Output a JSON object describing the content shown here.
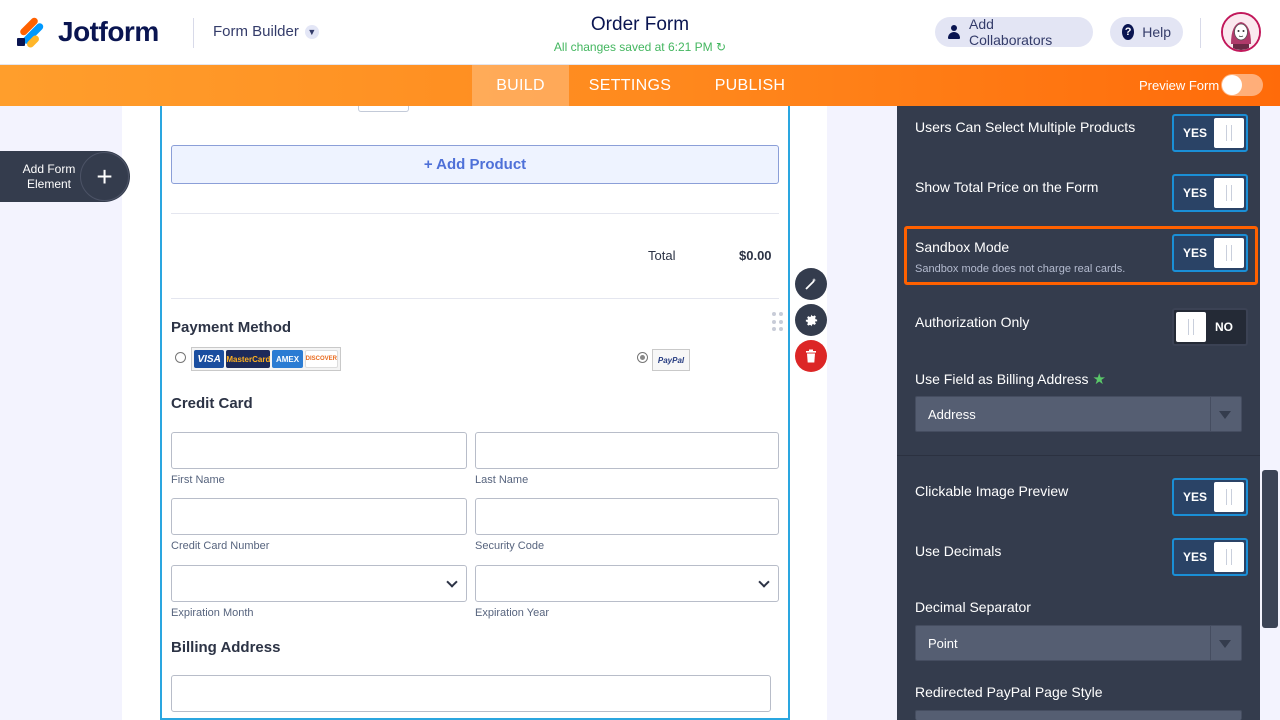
{
  "header": {
    "logo_text": "Jotform",
    "app_menu": "Form Builder",
    "form_title": "Order Form",
    "save_status": "All changes saved at 6:21 PM",
    "collaborators_label": "Add Collaborators",
    "help_label": "Help"
  },
  "tabs": {
    "build": "BUILD",
    "settings": "SETTINGS",
    "publish": "PUBLISH"
  },
  "preview_form_label": "Preview Form",
  "sidebar": {
    "add_form_element": "Add Form Element"
  },
  "form": {
    "add_product": "+ Add Product",
    "total_label": "Total",
    "total_value": "$0.00",
    "payment_method_title": "Payment Method",
    "cards": [
      "VISA",
      "MasterCard",
      "AMEX",
      "DISCOVER"
    ],
    "paypal_label": "PayPal",
    "credit_card_title": "Credit Card",
    "fields": {
      "first_name": "First Name",
      "last_name": "Last Name",
      "card_number": "Credit Card Number",
      "security_code": "Security Code",
      "exp_month": "Expiration Month",
      "exp_year": "Expiration Year"
    },
    "billing_address_title": "Billing Address"
  },
  "panel": {
    "multiple_products": {
      "label": "Users Can Select Multiple Products",
      "state": "YES"
    },
    "show_total": {
      "label": "Show Total Price on the Form",
      "state": "YES"
    },
    "sandbox": {
      "label": "Sandbox Mode",
      "sub": "Sandbox mode does not charge real cards.",
      "state": "YES"
    },
    "auth_only": {
      "label": "Authorization Only",
      "state": "NO"
    },
    "billing_field": {
      "label": "Use Field as Billing Address",
      "star": "★",
      "value": "Address"
    },
    "image_preview": {
      "label": "Clickable Image Preview",
      "state": "YES"
    },
    "decimals": {
      "label": "Use Decimals",
      "state": "YES"
    },
    "decimal_separator": {
      "label": "Decimal Separator",
      "value": "Point"
    },
    "paypal_style": {
      "label": "Redirected PayPal Page Style"
    }
  },
  "colors": {
    "accent": "#ff6100",
    "panel": "#343c4d",
    "toggle_on": "#1a8fd6",
    "link_blue": "#4e70d8"
  }
}
